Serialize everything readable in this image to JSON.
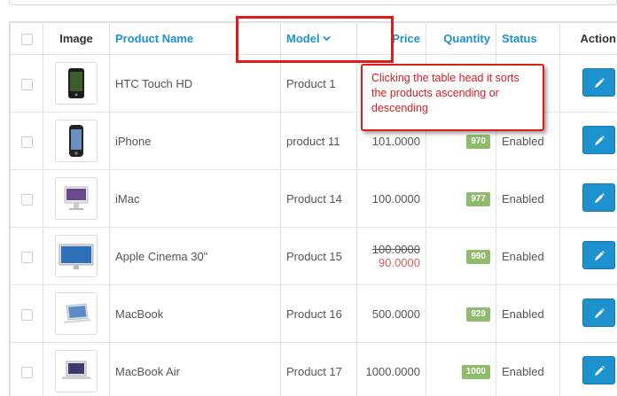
{
  "header": {
    "image": "Image",
    "product_name": "Product Name",
    "model": "Model",
    "price": "Price",
    "quantity": "Quantity",
    "status": "Status",
    "action": "Action"
  },
  "rows": [
    {
      "name": "HTC Touch HD",
      "model": "Product 1",
      "price": "",
      "special": "",
      "quantity": "",
      "status": "",
      "thumb": "phone-black"
    },
    {
      "name": "iPhone",
      "model": "product 11",
      "price": "101.0000",
      "special": "",
      "quantity": "970",
      "status": "Enabled",
      "thumb": "iphone"
    },
    {
      "name": "iMac",
      "model": "Product 14",
      "price": "100.0000",
      "special": "",
      "quantity": "977",
      "status": "Enabled",
      "thumb": "imac"
    },
    {
      "name": "Apple Cinema 30\"",
      "model": "Product 15",
      "price": "100.0000",
      "special": "90.0000",
      "quantity": "990",
      "status": "Enabled",
      "thumb": "cinema-display"
    },
    {
      "name": "MacBook",
      "model": "Product 16",
      "price": "500.0000",
      "special": "",
      "quantity": "929",
      "status": "Enabled",
      "thumb": "macbook"
    },
    {
      "name": "MacBook Air",
      "model": "Product 17",
      "price": "1000.0000",
      "special": "",
      "quantity": "1000",
      "status": "Enabled",
      "thumb": "macbook-air"
    }
  ],
  "annotation": {
    "text": "Clicking the table head it sorts the products ascending or descending",
    "color": "#e31a1a"
  },
  "colors": {
    "link": "#1e91cf",
    "badge": "#8fbb6c",
    "special_price": "#e05d5d"
  },
  "icons": {
    "sort": "chevron-down-icon",
    "edit": "pencil-icon"
  }
}
